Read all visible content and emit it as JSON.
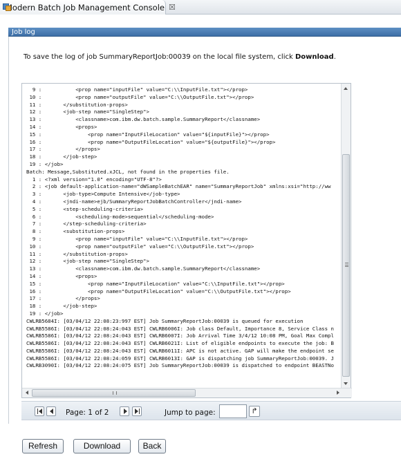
{
  "tab": {
    "title": "Modern Batch Job Management Console",
    "close_glyph": "☒",
    "icon": "app-icon"
  },
  "panel": {
    "title": "Job log"
  },
  "instruction": {
    "text": "To save the log of job SummaryReportJob:00039 on the local file system, click ",
    "link": "Download",
    "suffix": "."
  },
  "log_lines": [
    "  9 :           <prop name=\"inputFile\" value=\"C:\\\\InputFile.txt\"></prop>",
    " 10 :           <prop name=\"outputFile\" value=\"C:\\\\OutputFile.txt\"></prop>",
    " 11 :       </substitution-props>",
    " 12 :       <job-step name=\"SingleStep\">",
    " 13 :           <classname>com.ibm.dw.batch.sample.SummaryReport</classname>",
    " 14 :           <props>",
    " 15 :               <prop name=\"InputFileLocation\" value=\"${inputFile}\"></prop>",
    " 16 :               <prop name=\"OutputFileLocation\" value=\"${outputFile}\"></prop>",
    " 17 :           </props>",
    " 18 :       </job-step>",
    " 19 : </job>",
    "Batch: Message,Substituted.xJCL, not found in the properties file.",
    "  1 : <?xml version=\"1.0\" encoding=\"UTF-8\"?>",
    "  2 : <job default-application-name=\"dWSampleBatchEAR\" name=\"SummaryReportJob\" xmlns:xsi=\"http://ww",
    "  3 :       <job-type>Compute Intensive</job-type>",
    "  4 :       <jndi-name>ejb/SummaryReportJobBatchController</jndi-name>",
    "  5 :       <step-scheduling-criteria>",
    "  6 :           <scheduling-mode>sequential</scheduling-mode>",
    "  7 :       </step-scheduling-criteria>",
    "  8 :       <substitution-props>",
    "  9 :           <prop name=\"inputFile\" value=\"C:\\\\InputFile.txt\"></prop>",
    " 10 :           <prop name=\"outputFile\" value=\"C:\\\\OutputFile.txt\"></prop>",
    " 11 :       </substitution-props>",
    " 12 :       <job-step name=\"SingleStep\">",
    " 13 :           <classname>com.ibm.dw.batch.sample.SummaryReport</classname>",
    " 14 :           <props>",
    " 15 :               <prop name=\"InputFileLocation\" value=\"C:\\\\InputFile.txt\"></prop>",
    " 16 :               <prop name=\"OutputFileLocation\" value=\"C:\\\\OutputFile.txt\"></prop>",
    " 17 :           </props>",
    " 18 :       </job-step>",
    " 19 : </job>",
    "CWLRB5684I: [03/04/12 22:08:23:997 EST] Job SummaryReportJob:00039 is queued for execution",
    "CWLRB5586I: [03/04/12 22:08:24:043 EST] CWLRB6006I: Job class Default, Importance 8, Service Class n",
    "CWLRB5586I: [03/04/12 22:08:24:043 EST] CWLRB6007I: Job Arrival Time 3/4/12 10:08 PM, Goal Max Compl",
    "CWLRB5586I: [03/04/12 22:08:24:043 EST] CWLRB6021I: List of eligible endpoints to execute the job: B",
    "CWLRB5586I: [03/04/12 22:08:24:043 EST] CWLRB6011I: APC is not active. GAP will make the endpoint se",
    "CWLRB5586I: [03/04/12 22:08:24:059 EST] CWLRB6013I: GAP is dispatching job SummaryReportJob:00039. J",
    "CWLRB3090I: [03/04/12 22:08:24:075 EST] Job SummaryReportJob:00039 is dispatched to endpoint BEASTNo"
  ],
  "pager": {
    "page_label": "Page: 1 of 2",
    "current_page": 1,
    "total_pages": 2,
    "jump_label": "Jump to page:",
    "jump_value": "",
    "go_glyph": "↱"
  },
  "buttons": {
    "refresh": "Refresh",
    "download": "Download",
    "back": "Back"
  }
}
